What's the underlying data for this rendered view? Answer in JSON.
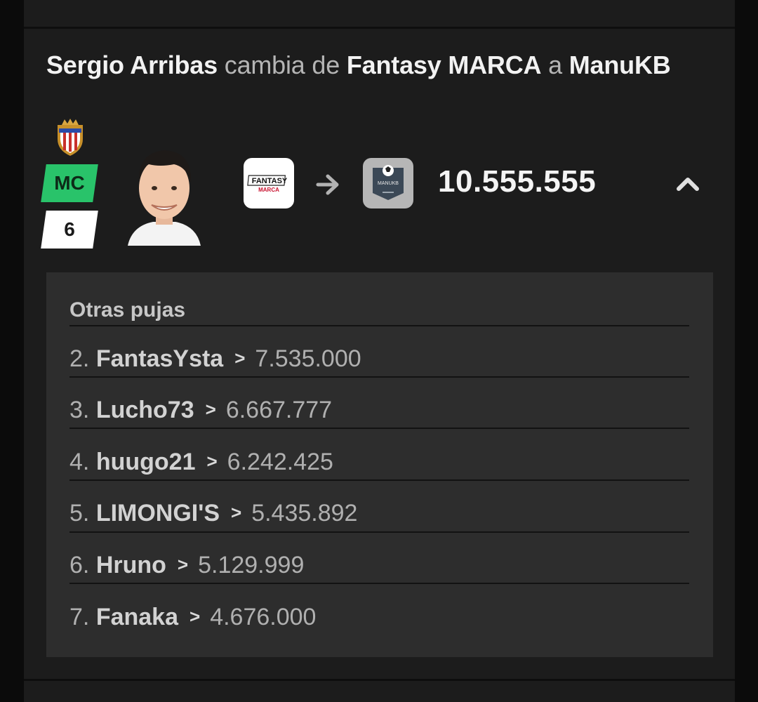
{
  "transfer": {
    "player_name": "Sergio Arribas",
    "verb": "cambia de",
    "from_team": "Fantasy MARCA",
    "connector": "a",
    "to_team": "ManuKB",
    "position": "MC",
    "points": "6",
    "from_logo_text_1": "FANTASY",
    "from_logo_text_2": "MARCA",
    "to_logo_text": "MANUKB",
    "price": "10.555.555"
  },
  "other_bids": {
    "title": "Otras pujas",
    "rows": [
      {
        "rank": "2.",
        "bidder": "FantasYsta",
        "amount": "7.535.000"
      },
      {
        "rank": "3.",
        "bidder": "Lucho73",
        "amount": "6.667.777"
      },
      {
        "rank": "4.",
        "bidder": "huugo21",
        "amount": "6.242.425"
      },
      {
        "rank": "5.",
        "bidder": "LIMONGI'S",
        "amount": "5.435.892"
      },
      {
        "rank": "6.",
        "bidder": "Hruno",
        "amount": "5.129.999"
      },
      {
        "rank": "7.",
        "bidder": "Fanaka",
        "amount": "4.676.000"
      }
    ]
  },
  "icons": {
    "crest": "club-crest-icon",
    "arrow": "arrow-right-icon",
    "collapse": "chevron-up-icon",
    "row_separator": "chevron-right-icon"
  },
  "colors": {
    "position_badge": "#29c36a",
    "panel": "#2d2d2d",
    "card": "#1c1c1c"
  }
}
